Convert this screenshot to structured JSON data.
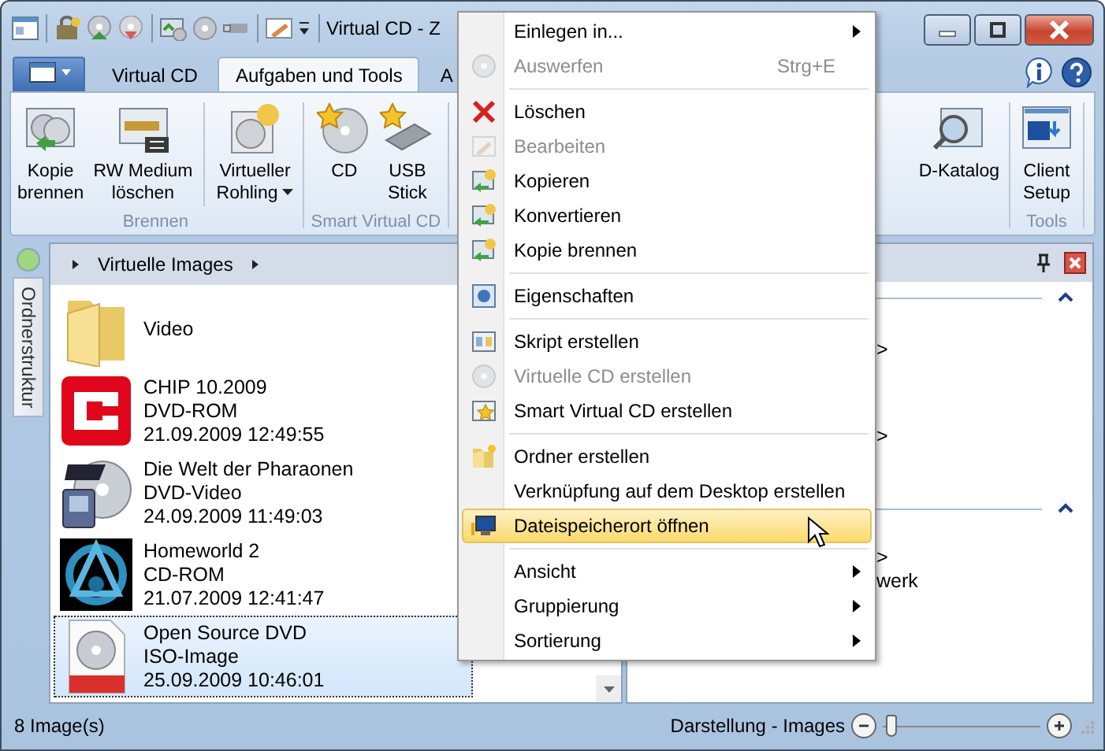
{
  "window": {
    "title": "Virtual CD - Z"
  },
  "tabs": [
    {
      "label": "Virtual CD",
      "selected": false
    },
    {
      "label": "Aufgaben und Tools",
      "selected": true
    },
    {
      "label": "A",
      "selected": false
    }
  ],
  "ribbon": {
    "groups": [
      {
        "label": "Brennen",
        "buttons": [
          {
            "lines": [
              "Kopie",
              "brennen"
            ],
            "dropdown": false
          },
          {
            "lines": [
              "RW Medium",
              "löschen"
            ],
            "dropdown": false
          },
          {
            "lines": [
              "Virtueller",
              "Rohling"
            ],
            "dropdown": true
          }
        ]
      },
      {
        "label": "Smart Virtual CD",
        "buttons": [
          {
            "lines": [
              "CD"
            ],
            "dropdown": false
          },
          {
            "lines": [
              "USB",
              "Stick"
            ],
            "dropdown": false
          }
        ]
      },
      {
        "buttons": [
          {
            "lines": [
              "D-Katalog"
            ],
            "dropdown": false
          }
        ]
      },
      {
        "label": "Tools",
        "buttons": [
          {
            "lines": [
              "Client",
              "Setup"
            ],
            "dropdown": false
          }
        ]
      }
    ]
  },
  "sidebar": {
    "label": "Ordnerstruktur"
  },
  "list": {
    "breadcrumb": "Virtuelle Images",
    "items": [
      {
        "name": "Video",
        "selected": false
      },
      {
        "name": "CHIP 10.2009",
        "type": "DVD-ROM",
        "date": "21.09.2009 12:49:55",
        "selected": false
      },
      {
        "name": "Die Welt der Pharaonen",
        "type": "DVD-Video",
        "date": "24.09.2009 11:49:03",
        "selected": false
      },
      {
        "name": "Homeworld 2",
        "type": "CD-ROM",
        "date": "21.07.2009 12:41:47",
        "selected": false
      },
      {
        "name": "Open Source DVD",
        "type": "ISO-Image",
        "date": "25.09.2009 10:46:01",
        "selected": true
      }
    ]
  },
  "details_panel": {
    "fragments": [
      ">",
      ">",
      ">",
      "werk"
    ]
  },
  "context_menu": {
    "items": [
      {
        "kind": "item",
        "label": "Einlegen in...",
        "disabled": false,
        "submenu": true,
        "highlighted": false
      },
      {
        "kind": "item",
        "label": "Auswerfen",
        "shortcut": "Strg+E",
        "disabled": true,
        "submenu": false,
        "highlighted": false
      },
      {
        "kind": "separator"
      },
      {
        "kind": "item",
        "label": "Löschen",
        "disabled": false,
        "submenu": false,
        "highlighted": false
      },
      {
        "kind": "item",
        "label": "Bearbeiten",
        "disabled": true,
        "submenu": false,
        "highlighted": false
      },
      {
        "kind": "item",
        "label": "Kopieren",
        "disabled": false,
        "submenu": false,
        "highlighted": false
      },
      {
        "kind": "item",
        "label": "Konvertieren",
        "disabled": false,
        "submenu": false,
        "highlighted": false
      },
      {
        "kind": "item",
        "label": "Kopie brennen",
        "disabled": false,
        "submenu": false,
        "highlighted": false
      },
      {
        "kind": "separator"
      },
      {
        "kind": "item",
        "label": "Eigenschaften",
        "disabled": false,
        "submenu": false,
        "highlighted": false
      },
      {
        "kind": "separator"
      },
      {
        "kind": "item",
        "label": "Skript erstellen",
        "disabled": false,
        "submenu": false,
        "highlighted": false
      },
      {
        "kind": "item",
        "label": "Virtuelle CD erstellen",
        "disabled": true,
        "submenu": false,
        "highlighted": false
      },
      {
        "kind": "item",
        "label": "Smart Virtual CD erstellen",
        "disabled": false,
        "submenu": false,
        "highlighted": false
      },
      {
        "kind": "separator"
      },
      {
        "kind": "item",
        "label": "Ordner erstellen",
        "disabled": false,
        "submenu": false,
        "highlighted": false
      },
      {
        "kind": "item",
        "label": "Verknüpfung auf dem Desktop erstellen",
        "disabled": false,
        "submenu": false,
        "highlighted": false
      },
      {
        "kind": "item",
        "label": "Dateispeicherort öffnen",
        "disabled": false,
        "submenu": false,
        "highlighted": true
      },
      {
        "kind": "separator"
      },
      {
        "kind": "item",
        "label": "Ansicht",
        "disabled": false,
        "submenu": true,
        "highlighted": false
      },
      {
        "kind": "item",
        "label": "Gruppierung",
        "disabled": false,
        "submenu": true,
        "highlighted": false
      },
      {
        "kind": "item",
        "label": "Sortierung",
        "disabled": false,
        "submenu": true,
        "highlighted": false
      }
    ]
  },
  "status_bar": {
    "count": "8 Image(s)",
    "view": "Darstellung - Images",
    "zoom": {
      "level": 0.05
    }
  }
}
